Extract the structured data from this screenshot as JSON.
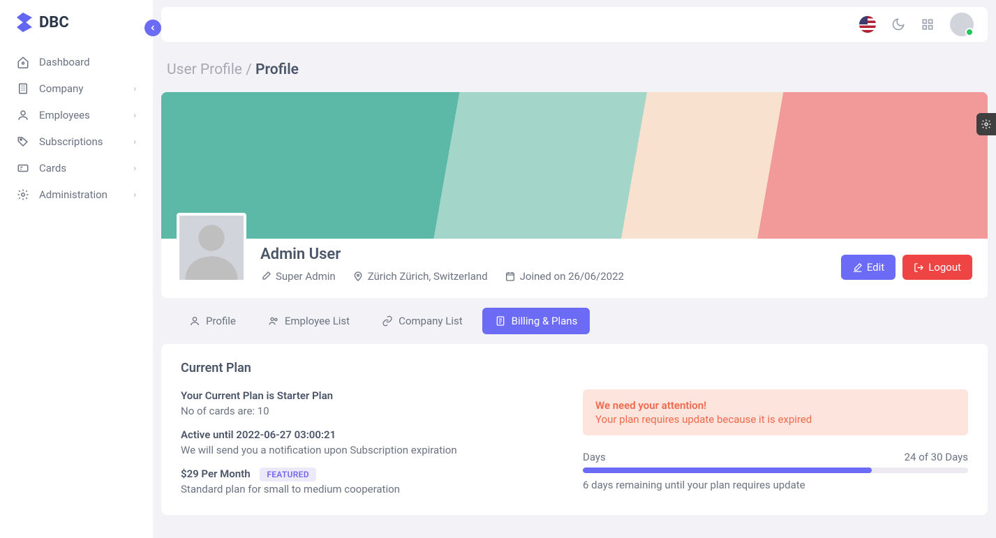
{
  "brand": {
    "title": "DBC"
  },
  "sidebar": {
    "items": [
      {
        "label": "Dashboard",
        "has_sub": false
      },
      {
        "label": "Company",
        "has_sub": true
      },
      {
        "label": "Employees",
        "has_sub": true
      },
      {
        "label": "Subscriptions",
        "has_sub": true
      },
      {
        "label": "Cards",
        "has_sub": true
      },
      {
        "label": "Administration",
        "has_sub": true
      }
    ]
  },
  "breadcrumb": {
    "parent": "User Profile",
    "sep": " / ",
    "current": "Profile"
  },
  "profile": {
    "name": "Admin User",
    "role": "Super Admin",
    "location": "Zürich Zürich, Switzerland",
    "joined": "Joined on 26/06/2022"
  },
  "actions": {
    "edit": "Edit",
    "logout": "Logout"
  },
  "tabs": [
    {
      "label": "Profile"
    },
    {
      "label": "Employee List"
    },
    {
      "label": "Company List"
    },
    {
      "label": "Billing & Plans"
    }
  ],
  "plan": {
    "heading": "Current Plan",
    "p1_title": "Your Current Plan is Starter Plan",
    "p1_sub": "No of cards are: 10",
    "p2_title": "Active until 2022-06-27 03:00:21",
    "p2_sub": "We will send you a notification upon Subscription expiration",
    "p3_title": "$29 Per Month",
    "p3_badge": "FEATURED",
    "p3_sub": "Standard plan for small to medium cooperation",
    "alert_title": "We need your attention!",
    "alert_body": "Your plan requires update because it is expired",
    "days_label": "Days",
    "days_count": "24 of 30 Days",
    "days_note": "6 days remaining until your plan requires update",
    "progress_pct": 75
  }
}
